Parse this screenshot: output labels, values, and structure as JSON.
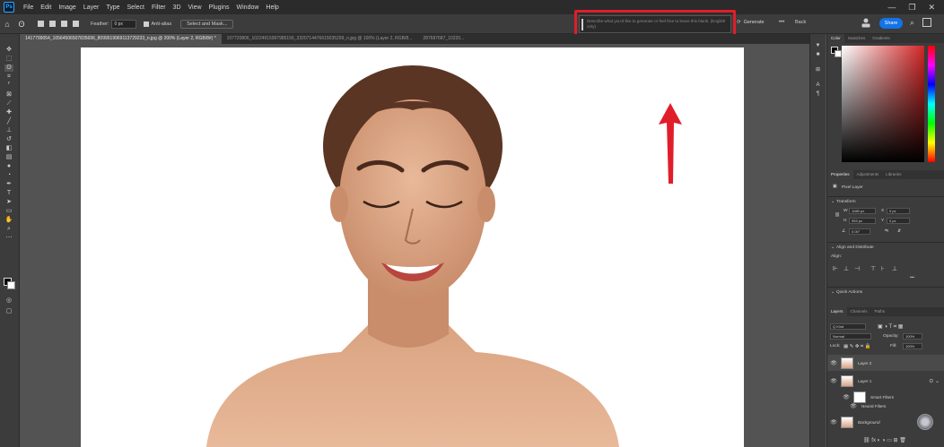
{
  "app": {
    "logo": "Ps"
  },
  "menu": [
    "File",
    "Edit",
    "Image",
    "Layer",
    "Type",
    "Select",
    "Filter",
    "3D",
    "View",
    "Plugins",
    "Window",
    "Help"
  ],
  "window_controls": {
    "minimize": "—",
    "restore": "❐",
    "close": "✕"
  },
  "options": {
    "feather_label": "Feather:",
    "feather_value": "0 px",
    "antialias_label": "Anti-alias",
    "select_mask_label": "Select and Mask..."
  },
  "generative": {
    "prompt_placeholder": "Describe what you'd like to generate or feel free to leave this blank. (English only)",
    "generate_label": "Generate",
    "more_label": "•••",
    "back_label": "Back"
  },
  "top_right": {
    "share_label": "Share"
  },
  "tabs": [
    "1417799054_10564506507835696_8099519969113729233_n.jpg @ 200% (Layer 2, RGB/8#) *",
    "107720806_10224915997985156_3320714476615035299_n.jpg @ 100% (Layer 2, RGB/8...",
    "287687687_10220..."
  ],
  "color_panel": {
    "tabs": [
      "Color",
      "Swatches",
      "Gradients"
    ]
  },
  "properties_panel": {
    "tabs": [
      "Properties",
      "Adjustments",
      "Libraries"
    ],
    "layer_type": "Pixel Layer",
    "transform_label": "Transform",
    "w_label": "W",
    "w_value": "1080 px",
    "x_label": "X",
    "x_value": "0 px",
    "h_label": "H",
    "h_value": "953 px",
    "y_label": "Y",
    "y_value": "0 px",
    "angle_value": "0.00°",
    "align_label": "Align and Distribute",
    "align_sub": "Align:",
    "quick_actions_label": "Quick Actions"
  },
  "layers_panel": {
    "tabs": [
      "Layers",
      "Channels",
      "Paths"
    ],
    "kind_label": "Q Kind",
    "blend_mode": "Normal",
    "opacity_label": "Opacity:",
    "opacity_value": "100%",
    "lock_label": "Lock:",
    "fill_label": "Fill:",
    "fill_value": "100%",
    "layers": [
      {
        "name": "Layer 2",
        "selected": true
      },
      {
        "name": "Layer 1",
        "selected": false
      },
      {
        "name": "Smart Filters",
        "selected": false
      },
      {
        "name": "Neural Filters",
        "selected": false
      },
      {
        "name": "Background",
        "selected": false
      }
    ]
  },
  "colors": {
    "highlight": "#e01e2a",
    "arrow": "#e01e2a",
    "share": "#1473e6",
    "accent": "#31a8ff"
  }
}
